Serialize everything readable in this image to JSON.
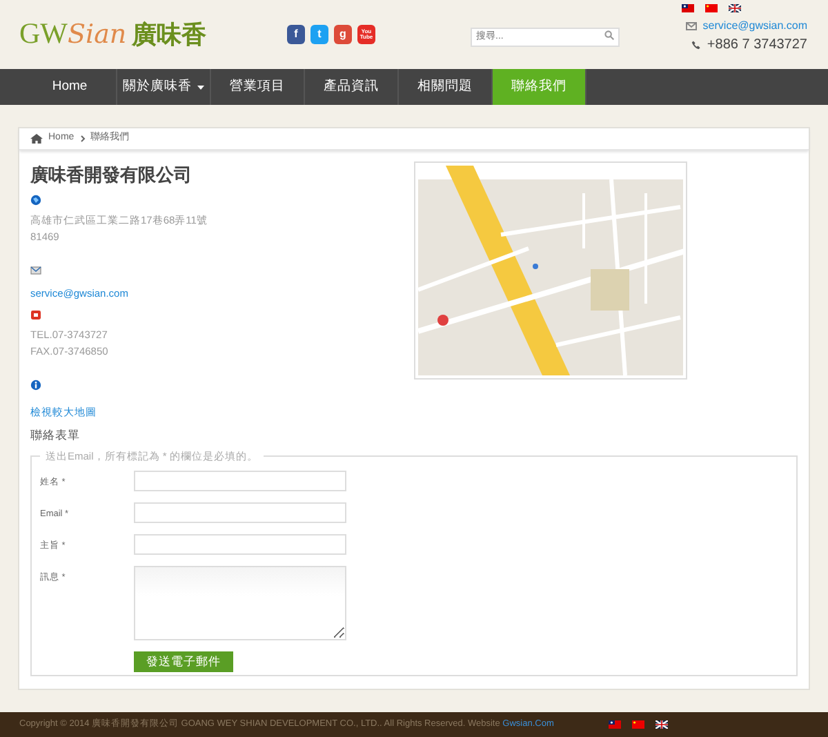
{
  "header": {
    "logo_latin": "GW",
    "logo_script": "Sian",
    "logo_cjk": "廣味香",
    "social": [
      {
        "kind": "facebook",
        "label": "f",
        "color": "#3b5998"
      },
      {
        "kind": "twitter",
        "label": "t",
        "color": "#1da1f2"
      },
      {
        "kind": "google",
        "label": "g",
        "color": "#dd4b39"
      },
      {
        "kind": "youtube",
        "label": "You Tube",
        "color": "#e52d27"
      }
    ],
    "search": {
      "placeholder": "搜尋..."
    },
    "languages": [
      {
        "kind": "tw"
      },
      {
        "kind": "cn"
      },
      {
        "kind": "uk"
      }
    ],
    "email": "service@gwsian.com",
    "phone": "+886 7 3743727"
  },
  "nav": [
    {
      "label": "Home",
      "selected": false,
      "dropdown": false
    },
    {
      "label": "關於廣味香",
      "selected": false,
      "dropdown": true
    },
    {
      "label": "營業項目",
      "selected": false,
      "dropdown": false
    },
    {
      "label": "產品資訊",
      "selected": false,
      "dropdown": false
    },
    {
      "label": "相關問題",
      "selected": false,
      "dropdown": false
    },
    {
      "label": "聯絡我們",
      "selected": true,
      "dropdown": false
    }
  ],
  "breadcrumb": [
    "Home",
    "聯絡我們"
  ],
  "contact": {
    "company": "廣味香開發有限公司",
    "blocks": [
      {
        "kind": "address",
        "lines": [
          "高雄市仁武區工業二路17巷68弄11號",
          "81469"
        ]
      },
      {
        "kind": "email",
        "link": "service@gwsian.com"
      },
      {
        "kind": "phone",
        "lines": [
          "TEL.07-3743727",
          "FAX.07-3746850"
        ]
      },
      {
        "kind": "info",
        "link": "檢視較大地圖"
      }
    ]
  },
  "form": {
    "title": "聯絡表單",
    "legend": "送出Email，所有標記為 * 的欄位是必填的。",
    "fields": [
      {
        "label": "姓名 *",
        "kind": "input"
      },
      {
        "label": "Email *",
        "kind": "input"
      },
      {
        "label": "主旨 *",
        "kind": "input"
      },
      {
        "label": "訊息 *",
        "kind": "textarea"
      }
    ],
    "submit": "發送電子郵件"
  },
  "footer": {
    "copyright": "Copyright © 2014 廣味香開發有限公司 GOANG WEY SHIAN DEVELOPMENT CO., LTD.. All Rights Reserved. Website ",
    "link": "Gwsian.Com",
    "languages": [
      {
        "kind": "tw"
      },
      {
        "kind": "cn"
      },
      {
        "kind": "uk"
      }
    ]
  }
}
